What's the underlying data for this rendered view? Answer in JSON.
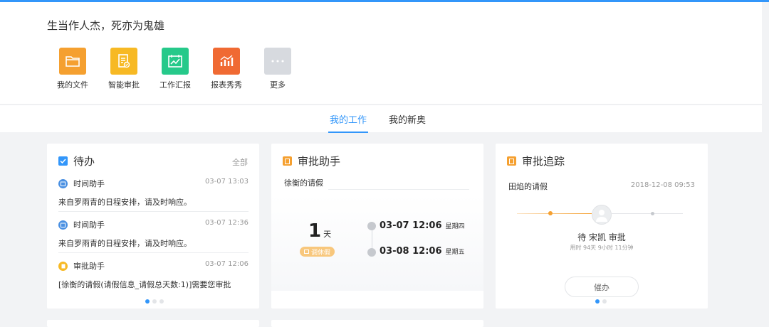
{
  "greeting": "生当作人杰，死亦为鬼雄",
  "apps": [
    {
      "label": "我的文件",
      "icon": "folder-icon",
      "color": "#f5a030"
    },
    {
      "label": "智能审批",
      "icon": "approval-doc-icon",
      "color": "#f7b924"
    },
    {
      "label": "工作汇报",
      "icon": "report-chart-icon",
      "color": "#26c98a"
    },
    {
      "label": "报表秀秀",
      "icon": "bar-chart-icon",
      "color": "#f06a33"
    },
    {
      "label": "更多",
      "icon": "more-dots-icon",
      "color": "#d7dadf"
    }
  ],
  "tabs": [
    {
      "label": "我的工作",
      "active": true
    },
    {
      "label": "我的新奥",
      "active": false
    }
  ],
  "todo": {
    "title": "待办",
    "more_label": "全部",
    "items": [
      {
        "source": "时间助手",
        "time": "03-07 13:03",
        "content": "来自罗雨青的日程安排，请及时响应。",
        "icon": "calendar-icon",
        "color": "#4a90e2"
      },
      {
        "source": "时间助手",
        "time": "03-07 12:36",
        "content": "来自罗雨青的日程安排，请及时响应。",
        "icon": "calendar-icon",
        "color": "#4a90e2"
      },
      {
        "source": "审批助手",
        "time": "03-07 12:06",
        "content": "[徐衡的请假(请假信息_请假总天数:1)]需要您审批",
        "icon": "approval-icon",
        "color": "#f7b924"
      }
    ]
  },
  "approval_helper": {
    "title": "审批助手",
    "subject": "徐衡的请假",
    "days_value": "1",
    "days_unit": "天",
    "leave_type": "调休假",
    "start_date": "03-07 12:06",
    "start_weekday": "星期四",
    "end_date": "03-08 12:06",
    "end_weekday": "星期五"
  },
  "approval_tracking": {
    "title": "审批追踪",
    "subject": "田焰的请假",
    "time": "2018-12-08 09:53",
    "status": "待 宋凯 审批",
    "elapsed": "用时 94天 9小时 11分钟",
    "urge_label": "催办"
  },
  "colors": {
    "accent": "#3296fa",
    "orange_title_icon": "#f5a030",
    "progress_orange": "#f5a030"
  }
}
